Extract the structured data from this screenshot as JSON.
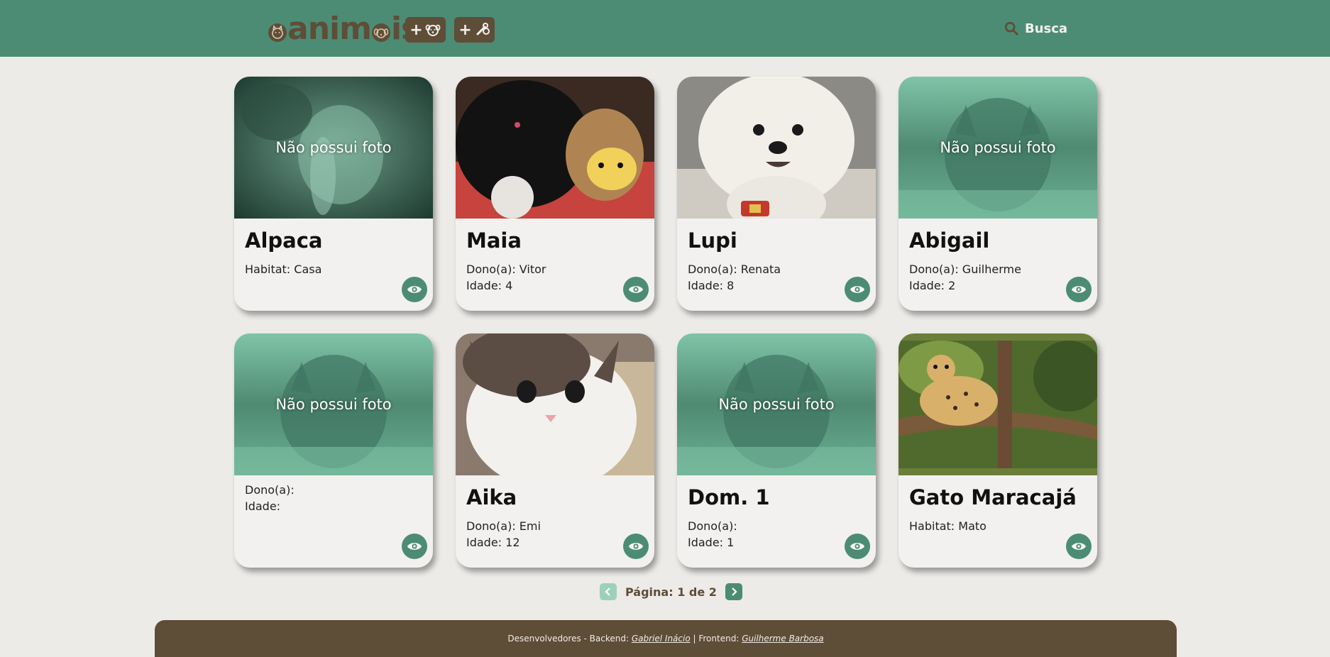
{
  "header": {
    "logo": {
      "part1": "anim",
      "part2": "is"
    },
    "add_buttons": [
      {
        "label": "+",
        "icon": "dog-face-icon"
      },
      {
        "label": "+",
        "icon": "paw-bone-icon"
      }
    ],
    "search_label": "Busca",
    "colors": {
      "background": "#4c8c75",
      "brand": "#5e4d37"
    }
  },
  "cards": [
    {
      "name": "Alpaca",
      "line1": "Habitat: Casa",
      "line2": "",
      "no_photo": "Não possui foto"
    },
    {
      "name": "Maia",
      "line1": "Dono(a): Vitor",
      "line2": "Idade: 4",
      "no_photo": ""
    },
    {
      "name": "Lupi",
      "line1": "Dono(a): Renata",
      "line2": "Idade: 8",
      "no_photo": ""
    },
    {
      "name": "Abigail",
      "line1": "Dono(a): Guilherme",
      "line2": "Idade: 2",
      "no_photo": "Não possui foto"
    },
    {
      "name": "",
      "line1": "Dono(a):",
      "line2": "Idade:",
      "no_photo": "Não possui foto"
    },
    {
      "name": "Aika",
      "line1": "Dono(a): Emi",
      "line2": "Idade: 12",
      "no_photo": ""
    },
    {
      "name": "Dom. 1",
      "line1": "Dono(a):",
      "line2": "Idade: 1",
      "no_photo": "Não possui foto"
    },
    {
      "name": "Gato Maracajá",
      "line1": "Habitat: Mato",
      "line2": "",
      "no_photo": ""
    }
  ],
  "pagination": {
    "text": "Página: 1 de 2"
  },
  "footer": {
    "prefix": "Desenvolvedores - Backend: ",
    "backend_name": "Gabriel Inácio",
    "separator": " | Frontend: ",
    "frontend_name": "Guilherme Barbosa"
  }
}
